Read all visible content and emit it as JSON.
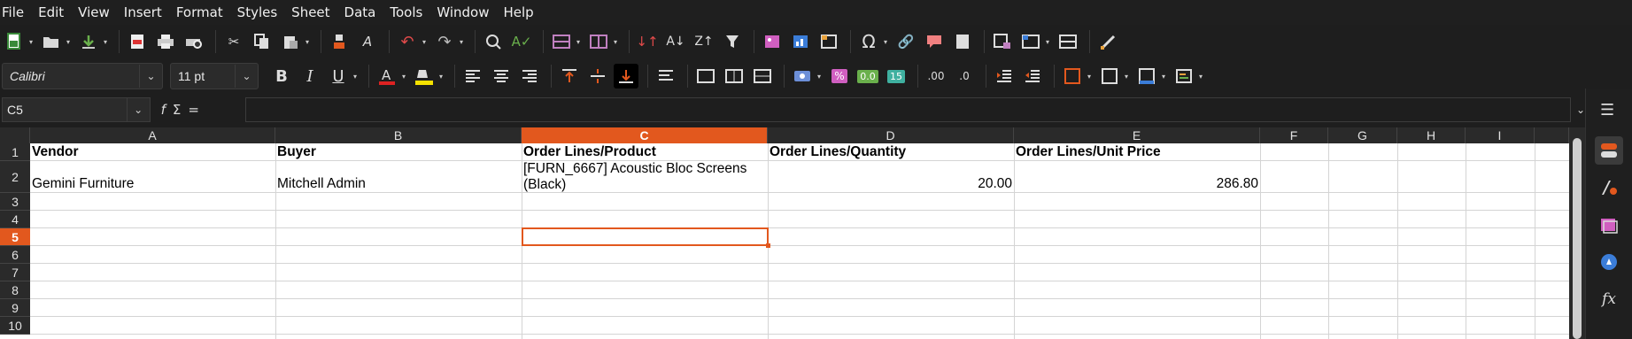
{
  "menubar": {
    "items": [
      "File",
      "Edit",
      "View",
      "Insert",
      "Format",
      "Styles",
      "Sheet",
      "Data",
      "Tools",
      "Window",
      "Help"
    ]
  },
  "formatting": {
    "font_name": "Calibri",
    "font_size": "11 pt"
  },
  "formula_bar": {
    "cell_reference": "C5",
    "content": ""
  },
  "sheet": {
    "columns": [
      "A",
      "B",
      "C",
      "D",
      "E",
      "F",
      "G",
      "H",
      "I"
    ],
    "active_column": "C",
    "rows": [
      "1",
      "2",
      "3",
      "4",
      "5",
      "6",
      "7",
      "8",
      "9",
      "10"
    ],
    "active_row": "5",
    "header_row": {
      "A": "Vendor",
      "B": "Buyer",
      "C": "Order Lines/Product",
      "D": "Order Lines/Quantity",
      "E": "Order Lines/Unit Price"
    },
    "data_row": {
      "A": "Gemini Furniture",
      "B": "Mitchell Admin",
      "C": "[FURN_6667] Acoustic Bloc Screens (Black)",
      "D": "20.00",
      "E": "286.80"
    }
  },
  "colors": {
    "accent": "#e2581e",
    "background": "#1e1e1e",
    "grid": "#d4d4d4"
  },
  "icons": {
    "toolbar1": [
      "new-icon",
      "open-icon",
      "save-icon",
      "export-pdf-icon",
      "print-icon",
      "print-preview-icon",
      "cut-icon",
      "copy-icon",
      "paste-icon",
      "clone-format-icon",
      "clear-format-icon",
      "undo-icon",
      "redo-icon",
      "find-replace-icon",
      "spelling-icon",
      "row-icon",
      "column-icon",
      "sort-icon",
      "sort-ascending-icon",
      "sort-descending-icon",
      "autofilter-icon",
      "image-icon",
      "chart-icon",
      "pivot-table-icon",
      "special-character-icon",
      "hyperlink-icon",
      "comment-icon",
      "header-footer-icon",
      "define-print-area-icon",
      "freeze-rows-columns-icon",
      "split-window-icon",
      "show-draw-functions-icon"
    ],
    "toolbar2": [
      "bold-icon",
      "italic-icon",
      "underline-icon",
      "font-color-icon",
      "highlight-color-icon",
      "align-left-icon",
      "align-center-icon",
      "align-right-icon",
      "align-top-icon",
      "align-middle-icon",
      "align-bottom-icon",
      "wrap-text-icon",
      "merge-center-icon",
      "merge-cells-icon",
      "unmerge-cells-icon",
      "currency-icon",
      "percent-icon",
      "number-icon",
      "date-icon",
      "add-decimal-icon",
      "delete-decimal-icon",
      "increase-indent-icon",
      "decrease-indent-icon",
      "borders-icon",
      "border-style-icon",
      "border-color-icon",
      "conditional-icon"
    ],
    "sidebar": [
      "sidebar-menu-icon",
      "properties-icon",
      "styles-icon",
      "gallery-icon",
      "navigator-icon",
      "functions-icon"
    ]
  }
}
